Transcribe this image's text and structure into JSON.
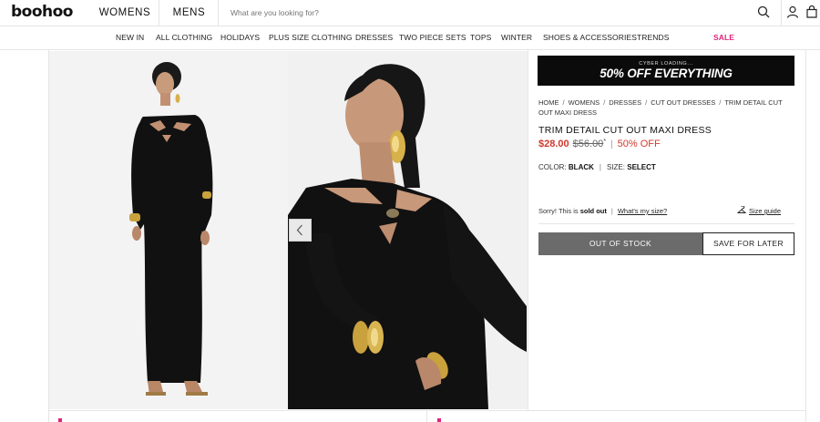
{
  "header": {
    "logo": "boohoo",
    "gender_tabs": [
      "WOMENS",
      "MENS"
    ],
    "search_placeholder": "What are you looking for?"
  },
  "nav": {
    "items": [
      "NEW IN",
      "ALL CLOTHING",
      "HOLIDAYS",
      "PLUS SIZE CLOTHING",
      "DRESSES",
      "TWO PIECE SETS",
      "TOPS",
      "WINTER",
      "SHOES & ACCESSORIES",
      "TRENDS",
      "",
      "SALE"
    ]
  },
  "banner": {
    "subtitle": "CYBER LOADING...",
    "headline": "50% OFF EVERYTHING"
  },
  "breadcrumb": [
    "HOME",
    "WOMENS",
    "DRESSES",
    "CUT OUT DRESSES",
    "TRIM DETAIL CUT OUT MAXI DRESS"
  ],
  "product": {
    "title": "TRIM DETAIL CUT OUT MAXI DRESS",
    "price": "$28.00",
    "original_price": "$56.00",
    "price_marker": "*",
    "discount": "50% OFF",
    "color_label": "COLOR:",
    "color_value": "BLACK",
    "size_label": "SIZE:",
    "size_value": "SELECT"
  },
  "availability": {
    "prefix": "Sorry! This is",
    "status": "sold out",
    "whats_my_size": "What's my size?",
    "size_guide": "Size guide"
  },
  "actions": {
    "out_of_stock": "OUT OF STOCK",
    "save_for_later": "SAVE FOR LATER"
  },
  "colors": {
    "sale_pink": "#e0237b",
    "price_red": "#d0392e",
    "disabled_button": "#6b6b6b"
  }
}
